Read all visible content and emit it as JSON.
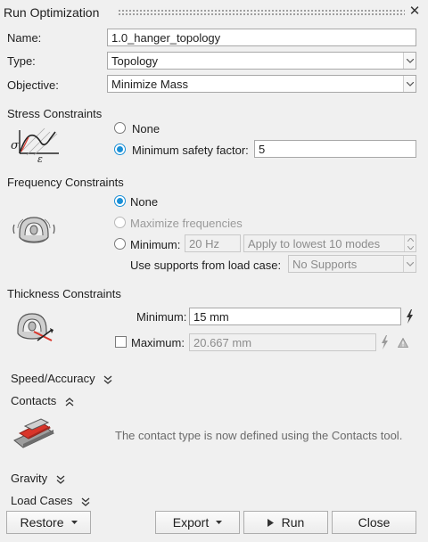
{
  "window": {
    "title": "Run Optimization",
    "close_glyph": "✕"
  },
  "form": {
    "name_label": "Name:",
    "name_value": "1.0_hanger_topology",
    "type_label": "Type:",
    "type_value": "Topology",
    "objective_label": "Objective:",
    "objective_value": "Minimize Mass"
  },
  "stress": {
    "heading": "Stress Constraints",
    "none_label": "None",
    "min_safety_label": "Minimum safety factor:",
    "min_safety_value": "5",
    "selected": "min_safety"
  },
  "frequency": {
    "heading": "Frequency Constraints",
    "none_label": "None",
    "maximize_label": "Maximize frequencies",
    "minimum_label": "Minimum:",
    "minimum_value": "20 Hz",
    "apply_modes_value": "Apply to lowest 10 modes",
    "supports_label": "Use supports from load case:",
    "supports_value": "No Supports",
    "selected": "none"
  },
  "thickness": {
    "heading": "Thickness Constraints",
    "minimum_label": "Minimum:",
    "minimum_value": "15 mm",
    "maximum_label": "Maximum:",
    "maximum_value": "20.667 mm",
    "maximum_checked": false
  },
  "speed": {
    "heading": "Speed/Accuracy"
  },
  "contacts": {
    "heading": "Contacts",
    "message": "The contact type is now defined using the Contacts tool."
  },
  "gravity": {
    "heading": "Gravity"
  },
  "load_cases": {
    "heading": "Load Cases"
  },
  "footer": {
    "restore_label": "Restore",
    "export_label": "Export",
    "run_label": "Run",
    "close_label": "Close"
  },
  "colors": {
    "accent": "#1a8fd6",
    "background": "#f0f0f0",
    "icon_red": "#d9352a"
  }
}
